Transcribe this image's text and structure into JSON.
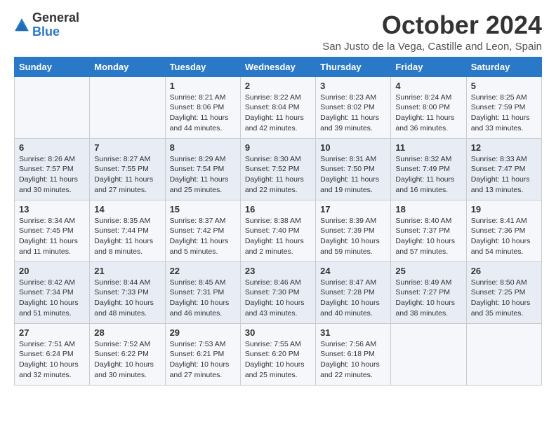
{
  "logo": {
    "text_general": "General",
    "text_blue": "Blue"
  },
  "header": {
    "month_title": "October 2024",
    "location": "San Justo de la Vega, Castille and Leon, Spain"
  },
  "days_of_week": [
    "Sunday",
    "Monday",
    "Tuesday",
    "Wednesday",
    "Thursday",
    "Friday",
    "Saturday"
  ],
  "weeks": [
    [
      {
        "day": "",
        "info": ""
      },
      {
        "day": "",
        "info": ""
      },
      {
        "day": "1",
        "info": "Sunrise: 8:21 AM\nSunset: 8:06 PM\nDaylight: 11 hours and 44 minutes."
      },
      {
        "day": "2",
        "info": "Sunrise: 8:22 AM\nSunset: 8:04 PM\nDaylight: 11 hours and 42 minutes."
      },
      {
        "day": "3",
        "info": "Sunrise: 8:23 AM\nSunset: 8:02 PM\nDaylight: 11 hours and 39 minutes."
      },
      {
        "day": "4",
        "info": "Sunrise: 8:24 AM\nSunset: 8:00 PM\nDaylight: 11 hours and 36 minutes."
      },
      {
        "day": "5",
        "info": "Sunrise: 8:25 AM\nSunset: 7:59 PM\nDaylight: 11 hours and 33 minutes."
      }
    ],
    [
      {
        "day": "6",
        "info": "Sunrise: 8:26 AM\nSunset: 7:57 PM\nDaylight: 11 hours and 30 minutes."
      },
      {
        "day": "7",
        "info": "Sunrise: 8:27 AM\nSunset: 7:55 PM\nDaylight: 11 hours and 27 minutes."
      },
      {
        "day": "8",
        "info": "Sunrise: 8:29 AM\nSunset: 7:54 PM\nDaylight: 11 hours and 25 minutes."
      },
      {
        "day": "9",
        "info": "Sunrise: 8:30 AM\nSunset: 7:52 PM\nDaylight: 11 hours and 22 minutes."
      },
      {
        "day": "10",
        "info": "Sunrise: 8:31 AM\nSunset: 7:50 PM\nDaylight: 11 hours and 19 minutes."
      },
      {
        "day": "11",
        "info": "Sunrise: 8:32 AM\nSunset: 7:49 PM\nDaylight: 11 hours and 16 minutes."
      },
      {
        "day": "12",
        "info": "Sunrise: 8:33 AM\nSunset: 7:47 PM\nDaylight: 11 hours and 13 minutes."
      }
    ],
    [
      {
        "day": "13",
        "info": "Sunrise: 8:34 AM\nSunset: 7:45 PM\nDaylight: 11 hours and 11 minutes."
      },
      {
        "day": "14",
        "info": "Sunrise: 8:35 AM\nSunset: 7:44 PM\nDaylight: 11 hours and 8 minutes."
      },
      {
        "day": "15",
        "info": "Sunrise: 8:37 AM\nSunset: 7:42 PM\nDaylight: 11 hours and 5 minutes."
      },
      {
        "day": "16",
        "info": "Sunrise: 8:38 AM\nSunset: 7:40 PM\nDaylight: 11 hours and 2 minutes."
      },
      {
        "day": "17",
        "info": "Sunrise: 8:39 AM\nSunset: 7:39 PM\nDaylight: 10 hours and 59 minutes."
      },
      {
        "day": "18",
        "info": "Sunrise: 8:40 AM\nSunset: 7:37 PM\nDaylight: 10 hours and 57 minutes."
      },
      {
        "day": "19",
        "info": "Sunrise: 8:41 AM\nSunset: 7:36 PM\nDaylight: 10 hours and 54 minutes."
      }
    ],
    [
      {
        "day": "20",
        "info": "Sunrise: 8:42 AM\nSunset: 7:34 PM\nDaylight: 10 hours and 51 minutes."
      },
      {
        "day": "21",
        "info": "Sunrise: 8:44 AM\nSunset: 7:33 PM\nDaylight: 10 hours and 48 minutes."
      },
      {
        "day": "22",
        "info": "Sunrise: 8:45 AM\nSunset: 7:31 PM\nDaylight: 10 hours and 46 minutes."
      },
      {
        "day": "23",
        "info": "Sunrise: 8:46 AM\nSunset: 7:30 PM\nDaylight: 10 hours and 43 minutes."
      },
      {
        "day": "24",
        "info": "Sunrise: 8:47 AM\nSunset: 7:28 PM\nDaylight: 10 hours and 40 minutes."
      },
      {
        "day": "25",
        "info": "Sunrise: 8:49 AM\nSunset: 7:27 PM\nDaylight: 10 hours and 38 minutes."
      },
      {
        "day": "26",
        "info": "Sunrise: 8:50 AM\nSunset: 7:25 PM\nDaylight: 10 hours and 35 minutes."
      }
    ],
    [
      {
        "day": "27",
        "info": "Sunrise: 7:51 AM\nSunset: 6:24 PM\nDaylight: 10 hours and 32 minutes."
      },
      {
        "day": "28",
        "info": "Sunrise: 7:52 AM\nSunset: 6:22 PM\nDaylight: 10 hours and 30 minutes."
      },
      {
        "day": "29",
        "info": "Sunrise: 7:53 AM\nSunset: 6:21 PM\nDaylight: 10 hours and 27 minutes."
      },
      {
        "day": "30",
        "info": "Sunrise: 7:55 AM\nSunset: 6:20 PM\nDaylight: 10 hours and 25 minutes."
      },
      {
        "day": "31",
        "info": "Sunrise: 7:56 AM\nSunset: 6:18 PM\nDaylight: 10 hours and 22 minutes."
      },
      {
        "day": "",
        "info": ""
      },
      {
        "day": "",
        "info": ""
      }
    ]
  ]
}
